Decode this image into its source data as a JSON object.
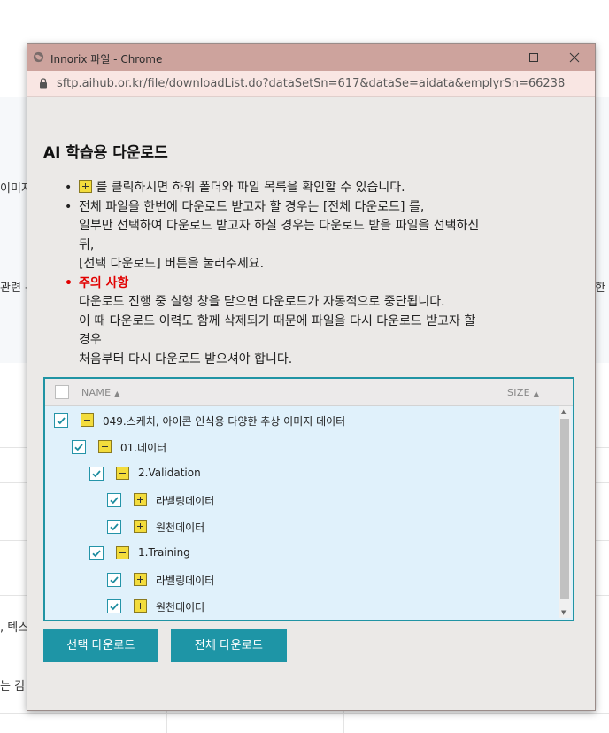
{
  "background": {
    "fragments": [
      "이미지",
      "관련 분",
      "한",
      ", 텍스",
      "는 검"
    ]
  },
  "window": {
    "title": "Innorix 파일 - Chrome",
    "url": "sftp.aihub.or.kr/file/downloadList.do?dataSetSn=617&dataSe=aidata&emplyrSn=66238"
  },
  "page": {
    "title": "AI 학습용 다운로드",
    "notes": {
      "n1_text": "를 클릭하시면 하위 폴더와 파일 목록을 확인할 수 있습니다.",
      "n2_line1": "전체 파일을 한번에 다운로드 받고자 할 경우는 [전체 다운로드] 를,",
      "n2_line2": "일부만 선택하여 다운로드 받고자 하실 경우는 다운로드 받을 파일을 선택하신",
      "n2_line3": "뒤,",
      "n2_line4": "[선택 다운로드] 버튼을 눌러주세요.",
      "n3_title": "주의 사항",
      "n3_line1": "다운로드 진행 중 실행 창을 닫으면 다운로드가 자동적으로 중단됩니다.",
      "n3_line2": "이 때 다운로드 이력도 함께 삭제되기 때문에 파일을 다시 다운로드 받고자 할",
      "n3_line3": "경우",
      "n3_line4": "처음부터 다시 다운로드 받으셔야 합니다."
    }
  },
  "tree": {
    "header": {
      "name": "NAME",
      "size": "SIZE",
      "sort_glyph": "▲"
    },
    "rows": [
      {
        "label": "049.스케치, 아이콘 인식용 다양한 추상 이미지 데이터",
        "state": "expanded",
        "checked": true,
        "depth": 0
      },
      {
        "label": "01.데이터",
        "state": "expanded",
        "checked": true,
        "depth": 1
      },
      {
        "label": "2.Validation",
        "state": "expanded",
        "checked": true,
        "depth": 2
      },
      {
        "label": "라벨링데이터",
        "state": "collapsed",
        "checked": true,
        "depth": 3
      },
      {
        "label": "원천데이터",
        "state": "collapsed",
        "checked": true,
        "depth": 3
      },
      {
        "label": "1.Training",
        "state": "expanded",
        "checked": true,
        "depth": 2
      },
      {
        "label": "라벨링데이터",
        "state": "collapsed",
        "checked": true,
        "depth": 3
      },
      {
        "label": "원천데이터",
        "state": "collapsed",
        "checked": true,
        "depth": 3
      }
    ]
  },
  "buttons": {
    "selected_download": "선택 다운로드",
    "all_download": "전체 다운로드"
  },
  "colors": {
    "accent": "#1e95a6",
    "warning": "#e20000",
    "toggle_yellow": "#f3dc3c",
    "titlebar": "#cda39d"
  }
}
